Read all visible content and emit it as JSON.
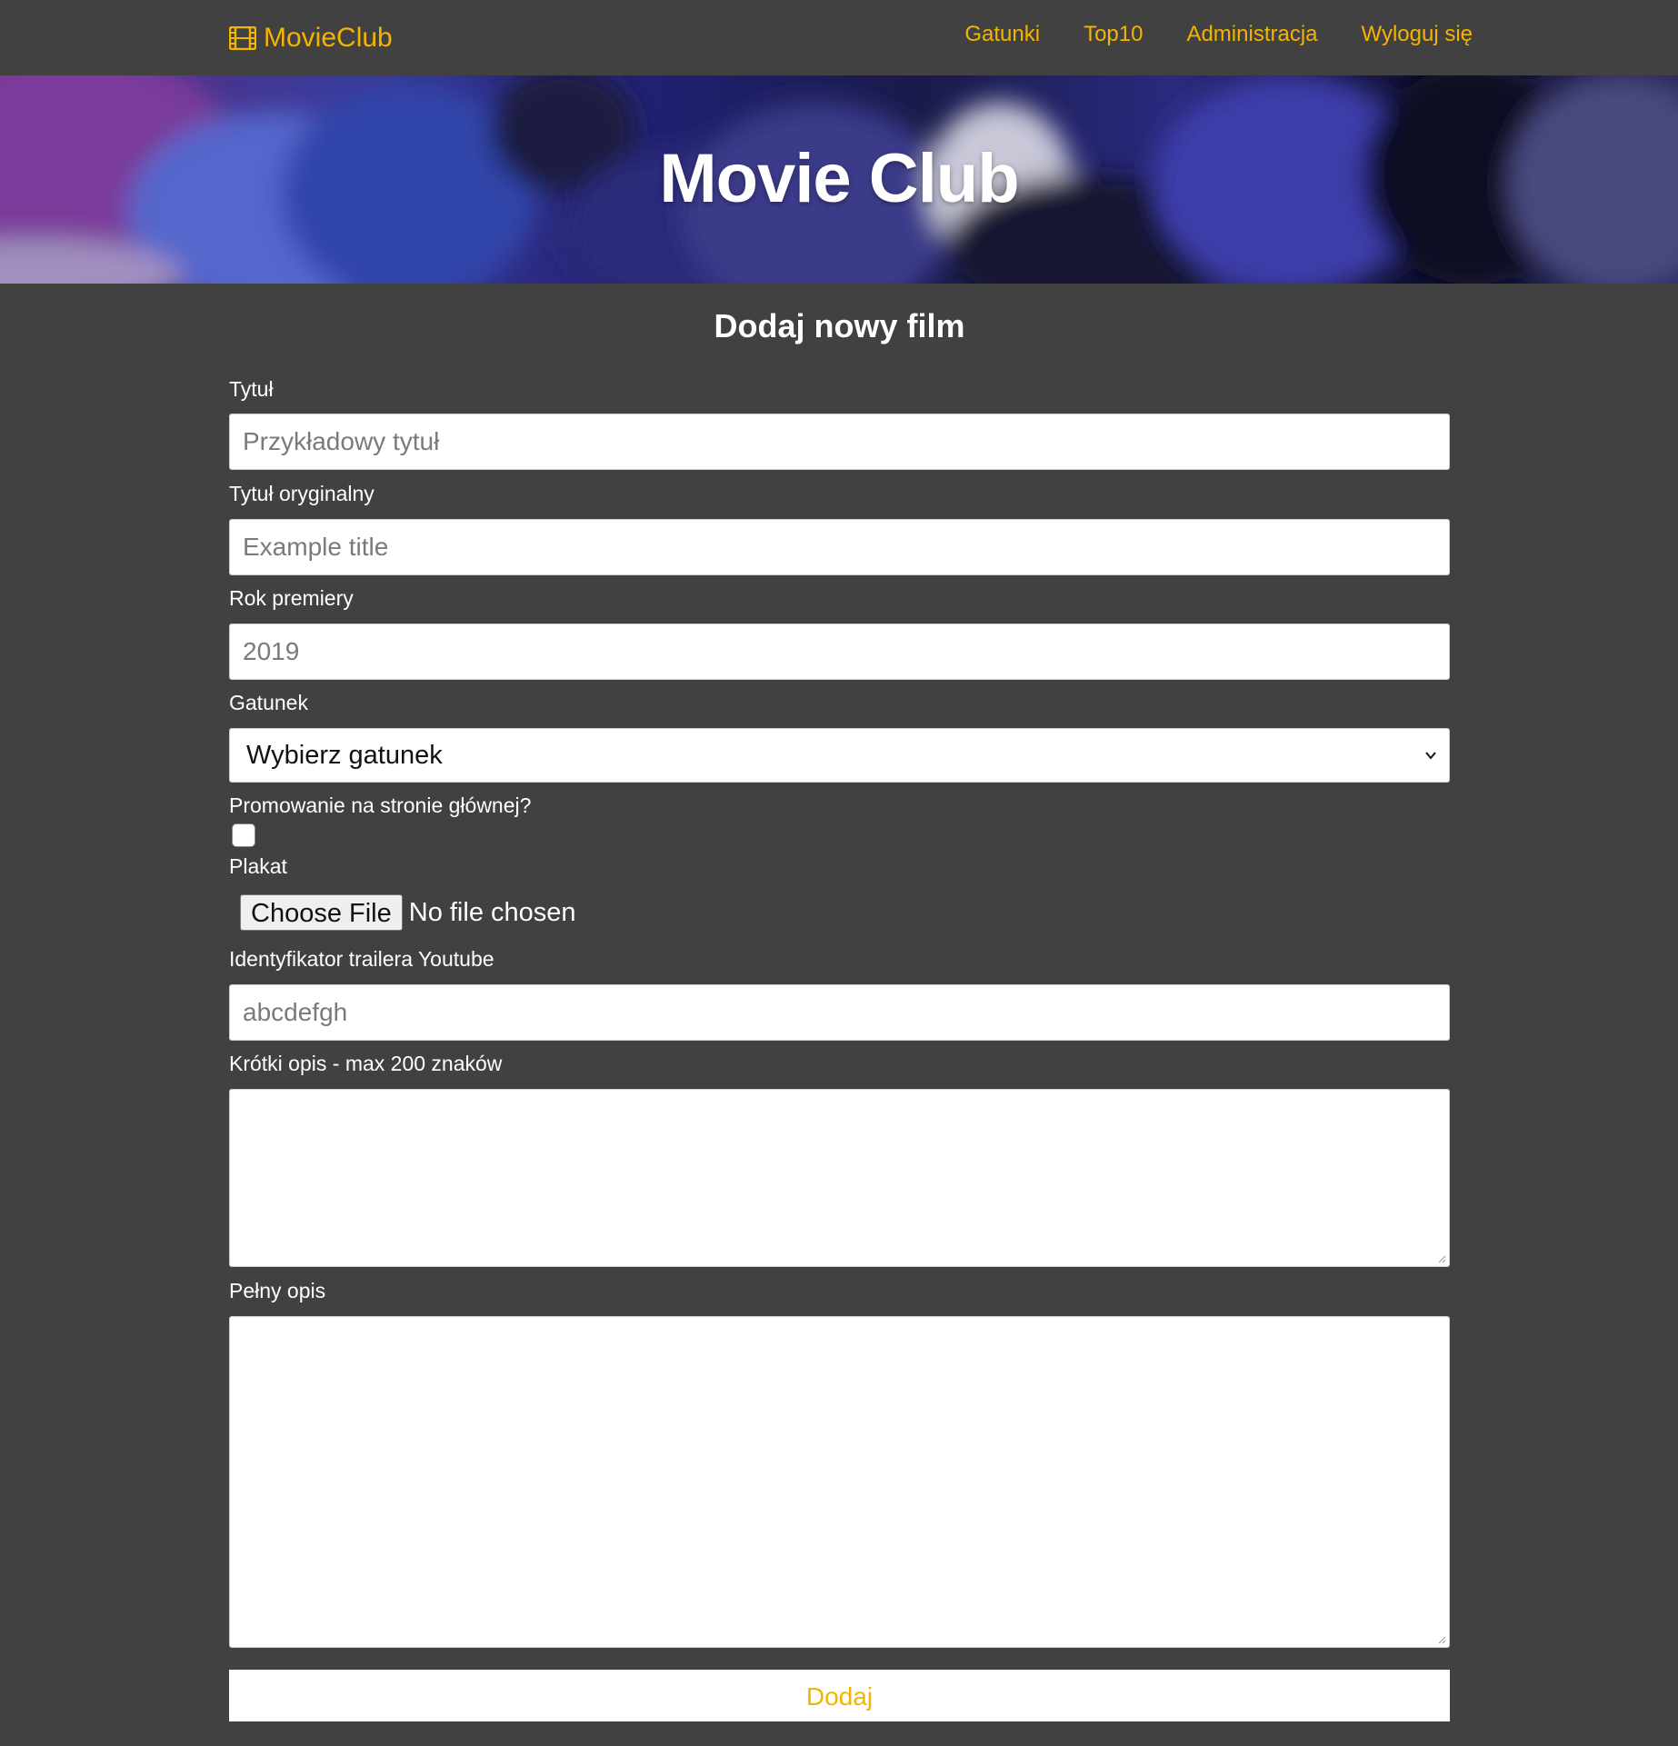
{
  "nav": {
    "brand": "MovieClub",
    "brand_icon": "film-icon",
    "links": [
      "Gatunki",
      "Top10",
      "Administracja",
      "Wyloguj się"
    ],
    "accent_color": "#f5b400"
  },
  "hero": {
    "title": "Movie Club"
  },
  "form": {
    "title": "Dodaj nowy film",
    "title_label": "Tytuł",
    "title_placeholder": "Przykładowy tytuł",
    "original_title_label": "Tytuł oryginalny",
    "original_title_placeholder": "Example title",
    "year_label": "Rok premiery",
    "year_placeholder": "2019",
    "genre_label": "Gatunek",
    "genre_selected": "Wybierz gatunek",
    "promote_label": "Promowanie na stronie głównej?",
    "poster_label": "Plakat",
    "file_button": "Choose File",
    "file_status": "No file chosen",
    "trailer_label": "Identyfikator trailera Youtube",
    "trailer_placeholder": "abcdefgh",
    "short_desc_label": "Krótki opis - max 200 znaków",
    "full_desc_label": "Pełny opis",
    "submit": "Dodaj"
  }
}
